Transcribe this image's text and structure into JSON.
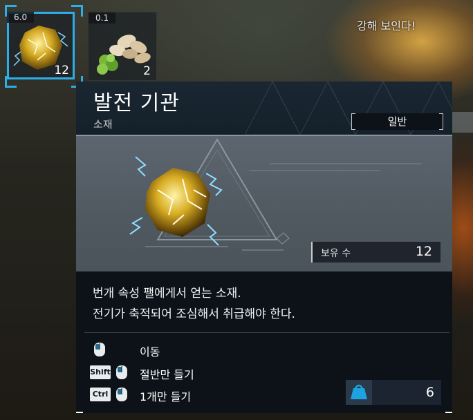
{
  "background": {
    "message": "강해 보인다!"
  },
  "inventory": {
    "slots": [
      {
        "weight": "6.0",
        "count": "12",
        "icon": "electric-ore-icon",
        "selected": true
      },
      {
        "weight": "0.1",
        "count": "2",
        "icon": "seeds-and-herb-icon",
        "selected": false
      }
    ]
  },
  "tooltip": {
    "title": "발전 기관",
    "category": "소재",
    "rarity": "일반",
    "owned_label": "보유 수",
    "owned_count": "12",
    "description": [
      "번개 속성 팰에게서 얻는 소재.",
      "전기가 축적되어 조심해서 취급해야 한다."
    ],
    "hints": [
      {
        "keys": [],
        "icon": "mouse-left-click-icon",
        "label": "이동"
      },
      {
        "keys": [
          "Shift"
        ],
        "icon": "mouse-left-click-icon",
        "label": "절반만 들기"
      },
      {
        "keys": [
          "Ctrl"
        ],
        "icon": "mouse-left-click-icon",
        "label": "1개만 들기"
      }
    ],
    "weight_icon": "weight-bag-icon",
    "weight": "6"
  },
  "colors": {
    "selection": "#2eaee6",
    "panel": "#0d1218",
    "weight_icon": "#1fa3e0"
  }
}
